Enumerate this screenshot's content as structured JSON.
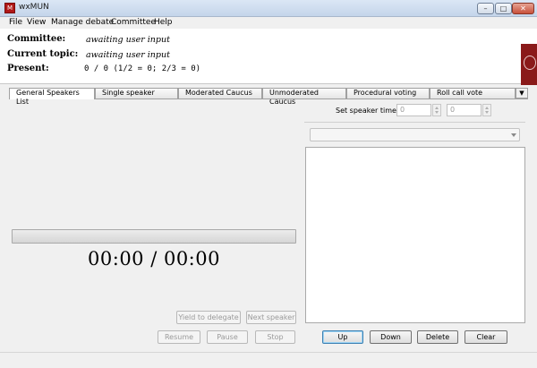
{
  "window": {
    "title": "wxMUN",
    "app_icon_text": "M",
    "minimize": "–",
    "maximize": "□",
    "close": "✕"
  },
  "menu": [
    "File",
    "View",
    "Manage debate",
    "Committee",
    "Help"
  ],
  "info": {
    "committee_label": "Committee:",
    "committee_value": "awaiting user input",
    "topic_label": "Current topic:",
    "topic_value": "awaiting user input",
    "present_label": "Present:",
    "present_value": "0 / 0  (1/2 = 0; 2/3 = 0)"
  },
  "tabs": {
    "items": [
      "General Speakers List",
      "Single speaker",
      "Moderated Caucus",
      "Unmoderated Caucus",
      "Procedural voting",
      "Roll call vote"
    ],
    "active_index": 0,
    "scroll_glyph": "▼"
  },
  "timer": {
    "display": "00:00 / 00:00",
    "progress_fraction": 0
  },
  "speaker_buttons": {
    "yield": "Yield to delegate",
    "next": "Next speaker",
    "resume": "Resume",
    "pause": "Pause",
    "stop": "Stop"
  },
  "speaker_time": {
    "label": "Set speaker time:",
    "minutes": "0",
    "seconds": "0"
  },
  "list_buttons": {
    "up": "Up",
    "down": "Down",
    "delete": "Delete",
    "clear": "Clear"
  },
  "colors": {
    "progress_fill": "#06b025",
    "flag": "#8a1a1a"
  }
}
